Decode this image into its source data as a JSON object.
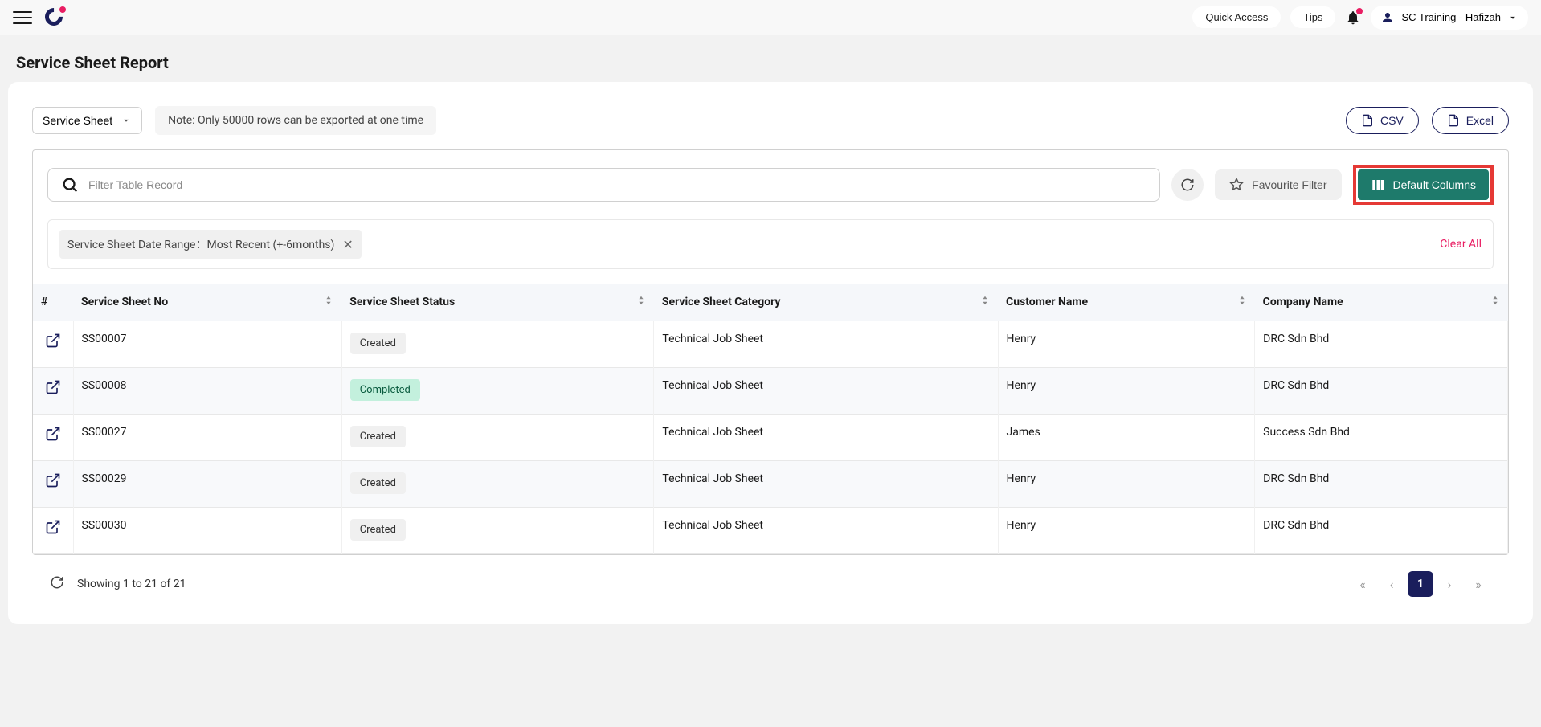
{
  "header": {
    "quick_access": "Quick Access",
    "tips": "Tips",
    "user_label": "SC Training - Hafizah"
  },
  "page": {
    "title": "Service Sheet Report"
  },
  "toolbar": {
    "dropdown_label": "Service Sheet",
    "note": "Note: Only 50000 rows can be exported at one time",
    "csv": "CSV",
    "excel": "Excel"
  },
  "filters": {
    "search_placeholder": "Filter Table Record",
    "favourite": "Favourite Filter",
    "default_columns": "Default Columns",
    "chip_text": "Service Sheet Date Range：Most Recent (+-6months)",
    "clear_all": "Clear All"
  },
  "columns": {
    "hash": "#",
    "no": "Service Sheet No",
    "status": "Service Sheet Status",
    "category": "Service Sheet Category",
    "customer": "Customer Name",
    "company": "Company Name"
  },
  "rows": [
    {
      "no": "SS00007",
      "status": "Created",
      "status_type": "created",
      "category": "Technical Job Sheet",
      "customer": "Henry",
      "company": "DRC Sdn Bhd"
    },
    {
      "no": "SS00008",
      "status": "Completed",
      "status_type": "completed",
      "category": "Technical Job Sheet",
      "customer": "Henry",
      "company": "DRC Sdn Bhd"
    },
    {
      "no": "SS00027",
      "status": "Created",
      "status_type": "created",
      "category": "Technical Job Sheet",
      "customer": "James",
      "company": "Success Sdn Bhd"
    },
    {
      "no": "SS00029",
      "status": "Created",
      "status_type": "created",
      "category": "Technical Job Sheet",
      "customer": "Henry",
      "company": "DRC Sdn Bhd"
    },
    {
      "no": "SS00030",
      "status": "Created",
      "status_type": "created",
      "category": "Technical Job Sheet",
      "customer": "Henry",
      "company": "DRC Sdn Bhd"
    }
  ],
  "pagination": {
    "info": "Showing 1 to 21 of 21",
    "current": "1"
  }
}
